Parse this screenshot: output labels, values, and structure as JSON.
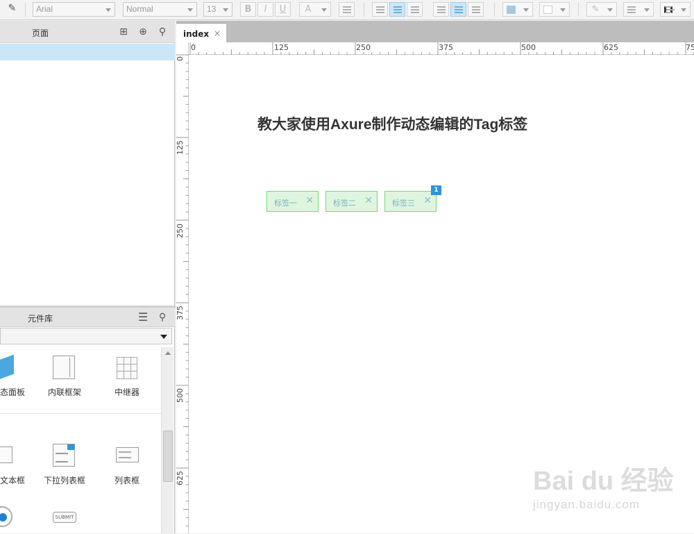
{
  "toolbar": {
    "font_family": "Arial",
    "font_style": "Normal",
    "font_size": "13"
  },
  "pages_panel": {
    "title": "页面"
  },
  "library_panel": {
    "title": "元件库",
    "widgets": [
      {
        "label": "态面板",
        "icon": "dynamic-panel-icon"
      },
      {
        "label": "内联框架",
        "icon": "inline-frame-icon"
      },
      {
        "label": "中继器",
        "icon": "repeater-icon"
      },
      {
        "label": "文本框",
        "icon": "text-field-icon"
      },
      {
        "label": "下拉列表框",
        "icon": "droplist-icon"
      },
      {
        "label": "列表框",
        "icon": "list-box-icon"
      },
      {
        "label": "",
        "icon": "radio-button-icon"
      },
      {
        "label": "SUBMIT",
        "icon": "submit-button-icon"
      }
    ]
  },
  "tabs": [
    {
      "label": "index",
      "close": "×"
    }
  ],
  "rulers": {
    "top": [
      "0",
      "125",
      "250",
      "375",
      "500",
      "625",
      "75"
    ],
    "left": [
      "0",
      "125",
      "250",
      "375",
      "500",
      "625"
    ]
  },
  "canvas": {
    "heading": "教大家使用Axure制作动态编辑的Tag标签",
    "tags": [
      {
        "label": "标签一",
        "close": "✕"
      },
      {
        "label": "标签二",
        "close": "✕"
      },
      {
        "label": "标签三",
        "close": "✕"
      }
    ],
    "badge": "1"
  },
  "watermark": {
    "brand": "Bai du 经验",
    "url": "jingyan.baidu.com"
  },
  "colors": {
    "accent": "#2b96de",
    "tag_bg": "#dff5df",
    "tag_border": "#74d974",
    "selection": "#c9e7f6"
  }
}
